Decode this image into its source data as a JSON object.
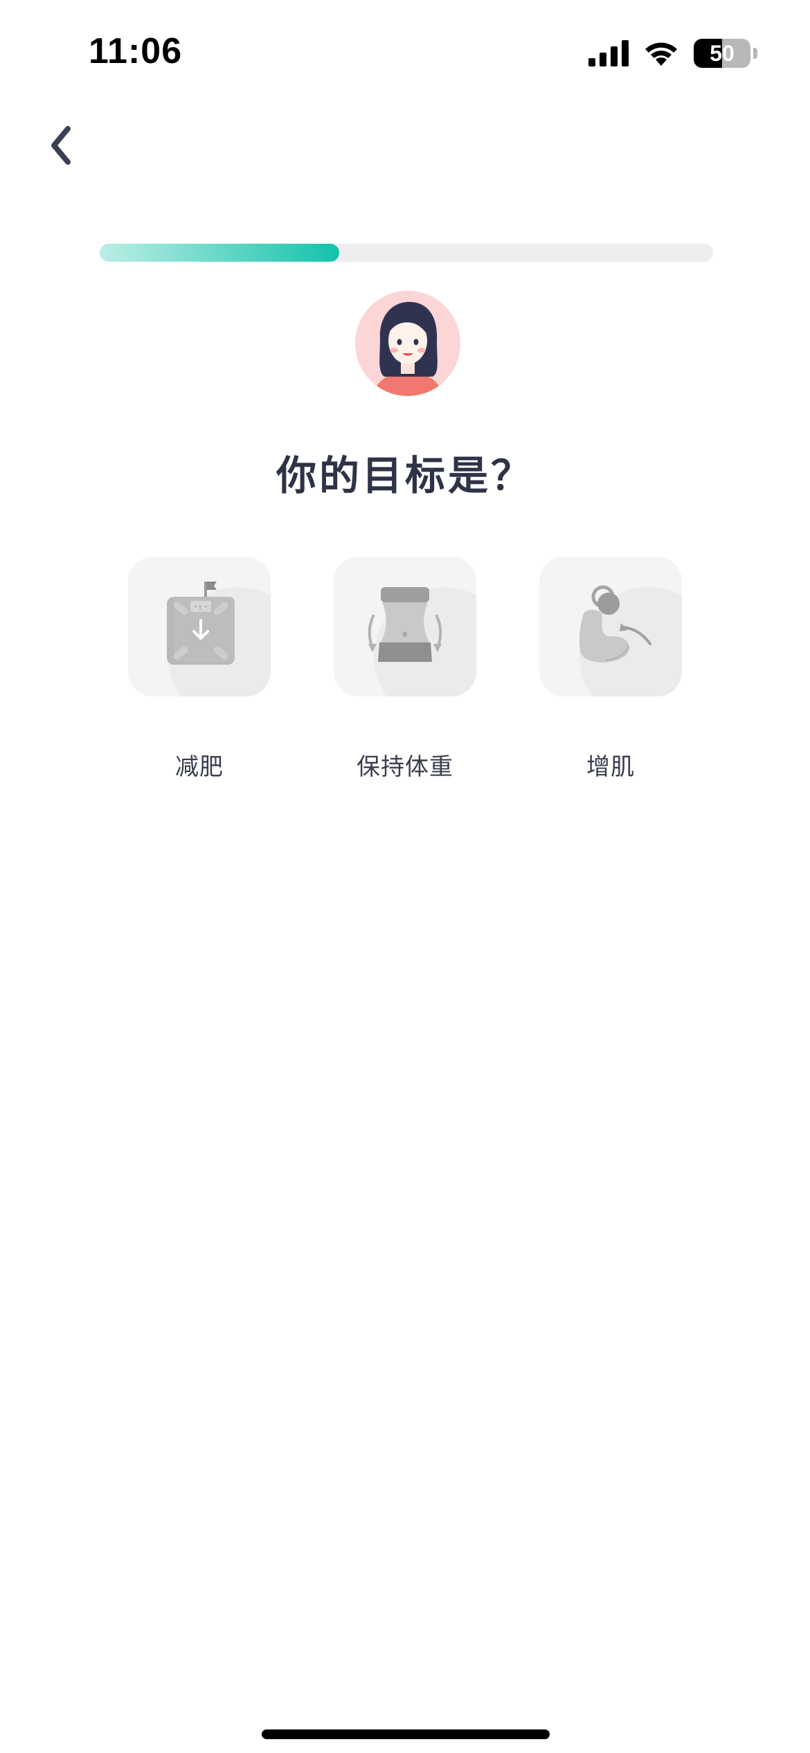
{
  "status_bar": {
    "time": "11:06",
    "battery_level": "50",
    "battery_fraction": 0.5
  },
  "header": {
    "back_icon": "chevron-left-icon"
  },
  "progress": {
    "fraction": 0.39,
    "accent_color": "#12c2ad"
  },
  "question": {
    "title": "你的目标是？"
  },
  "goals": [
    {
      "label": "减肥",
      "icon": "scale-down-icon"
    },
    {
      "label": "保持体重",
      "icon": "waist-icon"
    },
    {
      "label": "增肌",
      "icon": "muscle-arm-icon"
    }
  ],
  "colors": {
    "text_primary": "#2f3347",
    "card_bg": "#f4f4f4",
    "icon_gray": "#b5b5b5"
  }
}
